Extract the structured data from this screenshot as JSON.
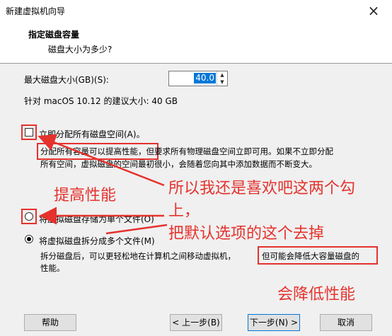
{
  "window": {
    "title": "新建虚拟机向导",
    "close_glyph": "×"
  },
  "header": {
    "title": "指定磁盘容量",
    "subtitle": "磁盘大小为多少?"
  },
  "disk": {
    "max_size_label": "最大磁盘大小(GB)(S):",
    "max_size_value": "40.0",
    "recommended": "针对 macOS 10.12 的建议大小: 40 GB"
  },
  "options": {
    "allocate_now": {
      "label": "立即分配所有磁盘空间(A)。",
      "checked": false,
      "desc_line1_highlight": "分配所有容量可以提高性能",
      "desc_line1_rest": "，但要求所有物理磁盘空间立即可用。如果不立即分配",
      "desc_line2": "所有空间，虚拟磁盘的空间最初很小，会随着您向其中添加数据而不断变大。"
    },
    "single_file": {
      "label": "将虚拟磁盘存储为单个文件(O)",
      "selected": false
    },
    "multiple_files": {
      "label": "将虚拟磁盘拆分成多个文件(M)",
      "selected": true,
      "desc_line1_a": "拆分磁盘后，可以更轻松地在计算机之间移动虚拟机，",
      "desc_line1_highlight": "但可能会降低大容量磁盘的",
      "desc_line2": "性能。"
    }
  },
  "annotations": {
    "improve_perf": "提高性能",
    "main_line1": "所以我还是喜欢吧这两个勾",
    "main_line2": "上，",
    "main_line3": "把默认选项的这个去掉",
    "reduce_perf": "会降低性能"
  },
  "footer": {
    "help": "帮助",
    "back": "< 上一步(B)",
    "next": "下一步(N) >",
    "cancel": "取消"
  },
  "colors": {
    "annotation_red": "#e5322d",
    "accent": "#0078d7"
  }
}
